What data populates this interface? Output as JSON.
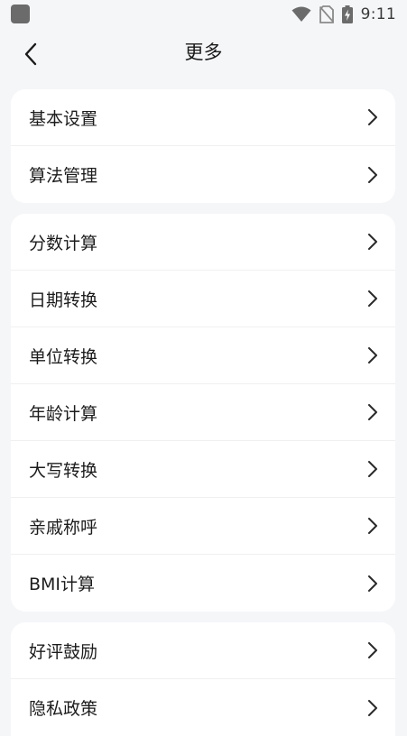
{
  "status_bar": {
    "time": "9:11"
  },
  "header": {
    "title": "更多"
  },
  "groups": [
    {
      "items": [
        {
          "label": "基本设置"
        },
        {
          "label": "算法管理"
        }
      ]
    },
    {
      "items": [
        {
          "label": "分数计算"
        },
        {
          "label": "日期转换"
        },
        {
          "label": "单位转换"
        },
        {
          "label": "年龄计算"
        },
        {
          "label": "大写转换"
        },
        {
          "label": "亲戚称呼"
        },
        {
          "label": "BMI计算"
        }
      ]
    },
    {
      "items": [
        {
          "label": "好评鼓励"
        },
        {
          "label": "隐私政策"
        }
      ]
    }
  ]
}
